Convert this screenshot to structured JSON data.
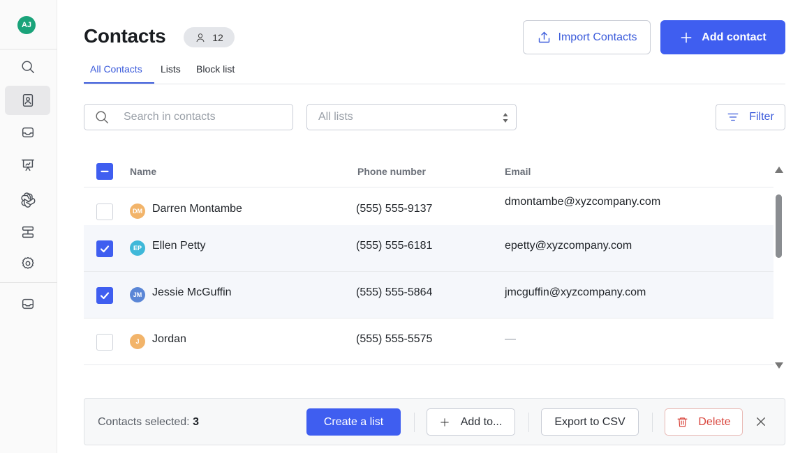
{
  "user": {
    "initials": "AJ",
    "avatar_color": "#1aa37a"
  },
  "sidebar": {
    "items": [
      {
        "name": "search",
        "icon": "search-icon"
      },
      {
        "name": "contacts",
        "icon": "contact-book-icon",
        "active": true
      },
      {
        "name": "inbox",
        "icon": "inbox-tray-icon"
      },
      {
        "name": "presentation",
        "icon": "presentation-board-icon"
      },
      {
        "name": "ai",
        "icon": "ai-spiral-icon"
      },
      {
        "name": "automation",
        "icon": "workflow-icon"
      },
      {
        "name": "settings",
        "icon": "gear-icon"
      },
      {
        "name": "messages",
        "icon": "message-tray-icon"
      }
    ]
  },
  "header": {
    "title": "Contacts",
    "contact_count": "12",
    "import_label": "Import Contacts",
    "add_label": "Add contact"
  },
  "tabs": [
    {
      "label": "All Contacts",
      "active": true
    },
    {
      "label": "Lists"
    },
    {
      "label": "Block list"
    }
  ],
  "search": {
    "placeholder": "Search in contacts"
  },
  "list_filter": {
    "selected": "All lists"
  },
  "filter_label": "Filter",
  "table": {
    "columns": [
      "Name",
      "Phone number",
      "Email"
    ],
    "rows": [
      {
        "initials": "DM",
        "name": "Darren Montambe",
        "phone": "(555) 555-9137",
        "email": "dmontambe@xyzcompany.com",
        "checked": false,
        "avatar_color": "#f2b46a"
      },
      {
        "initials": "EP",
        "name": "Ellen Petty",
        "phone": "(555) 555-6181",
        "email": "epetty@xyzcompany.com",
        "checked": true,
        "avatar_color": "#3fb8d9"
      },
      {
        "initials": "JM",
        "name": "Jessie McGuffin",
        "phone": "(555) 555-5864",
        "email": "jmcguffin@xyzcompany.com",
        "checked": true,
        "avatar_color": "#5a86d6"
      },
      {
        "initials": "J",
        "name": "Jordan",
        "phone": "(555) 555-5575",
        "email": "—",
        "checked": false,
        "avatar_color": "#f2b46a"
      }
    ]
  },
  "bulk_bar": {
    "selected_label": "Contacts selected:",
    "selected_count": "3",
    "create_list_label": "Create a list",
    "add_to_label": "Add to...",
    "export_label": "Export to CSV",
    "delete_label": "Delete"
  },
  "colors": {
    "accent": "#3f5ef0",
    "danger": "#d9453c"
  }
}
